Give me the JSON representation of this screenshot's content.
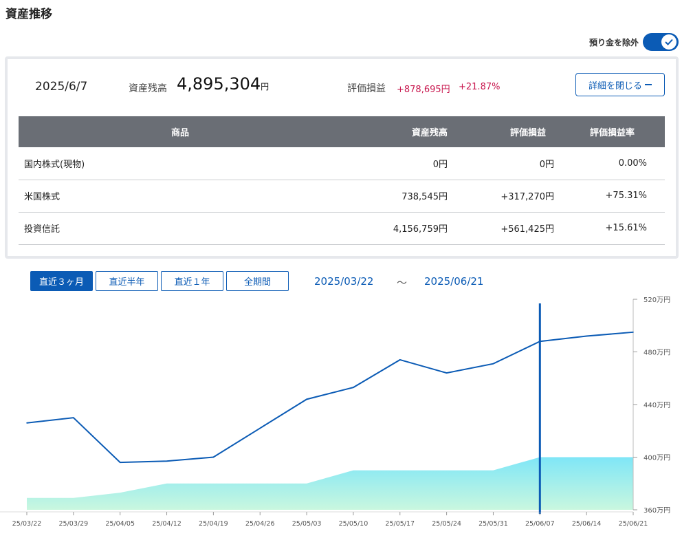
{
  "page": {
    "title": "資産推移"
  },
  "toggle": {
    "label": "預り金を除外",
    "on": true
  },
  "summary": {
    "date": "2025/6/7",
    "balance_label": "資産残高",
    "balance_value": "4,895,304",
    "balance_unit": "円",
    "pl_label": "評価損益",
    "pl_value": "+878,695円",
    "pl_pct": "+21.87%",
    "detail_button": "詳細を閉じる"
  },
  "holdings": {
    "headers": [
      "商品",
      "資産残高",
      "評価損益",
      "評価損益率"
    ],
    "rows": [
      {
        "name": "国内株式(現物)",
        "balance": "0円",
        "pl": "0円",
        "rate": "0.00%"
      },
      {
        "name": "米国株式",
        "balance": "738,545円",
        "pl": "+317,270円",
        "rate": "+75.31%"
      },
      {
        "name": "投資信託",
        "balance": "4,156,759円",
        "pl": "+561,425円",
        "rate": "+15.61%"
      }
    ]
  },
  "range": {
    "buttons": [
      "直近３ヶ月",
      "直近半年",
      "直近１年",
      "全期間"
    ],
    "active_index": 0,
    "start": "2025/03/22",
    "separator": "～",
    "end": "2025/06/21"
  },
  "colors": {
    "accent": "#0b5bb5",
    "positive": "#c8174e",
    "header_bg": "#6a6e75",
    "area_top": "#7fe6f7",
    "area_bottom": "#c9f7df"
  },
  "chart_data": {
    "type": "line",
    "x": [
      "25/03/22",
      "25/03/29",
      "25/04/05",
      "25/04/12",
      "25/04/19",
      "25/04/26",
      "25/05/03",
      "25/05/10",
      "25/05/17",
      "25/05/24",
      "25/05/31",
      "25/06/07",
      "25/06/14",
      "25/06/21"
    ],
    "series": [
      {
        "kind": "line",
        "values": [
          426,
          430,
          396,
          397,
          400,
          422,
          444,
          453,
          474,
          464,
          471,
          488,
          492,
          495
        ]
      },
      {
        "kind": "area",
        "values": [
          369,
          369,
          373,
          380,
          380,
          380,
          380,
          390,
          390,
          390,
          390,
          400,
          400,
          400
        ]
      }
    ],
    "y_ticks": [
      "520万円",
      "480万円",
      "440万円",
      "400万円",
      "360万円"
    ],
    "y_tick_values": [
      520,
      480,
      440,
      400,
      360
    ],
    "ylim": [
      360,
      520
    ],
    "cursor_date": "25/06/07",
    "axis_position": "right"
  }
}
